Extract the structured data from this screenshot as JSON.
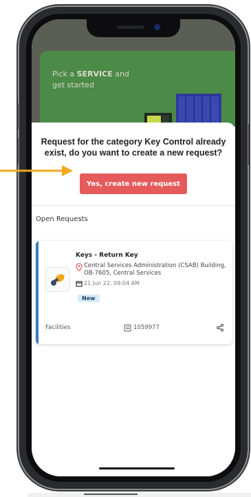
{
  "banner": {
    "line1_prefix": "Pick a ",
    "line1_bold": "SERVICE",
    "line1_suffix": " and",
    "line2": "get started"
  },
  "dialog": {
    "question": "Request for the category Key Control already exist, do you want to create a new request?",
    "confirm_label": "Yes, create new request"
  },
  "open_requests": {
    "section_title": "Open Requests",
    "items": [
      {
        "title": "Keys - Return Key",
        "location": "Central Services Administration (CSAB) Building, OB-7605, Central Services",
        "date": "21 Jun 22, 09:04 AM",
        "status": "New",
        "category": "Facilities",
        "request_id": "1059977"
      }
    ]
  },
  "colors": {
    "accent_red": "#e55b5b",
    "accent_blue": "#3a7bbf",
    "arrow_orange": "#f2a81d",
    "banner_green": "#4c8a47",
    "badge_bg": "#d6ecf7"
  },
  "icons": [
    "location-pin-icon",
    "calendar-icon",
    "tag-icon",
    "share-icon",
    "key-icon"
  ]
}
